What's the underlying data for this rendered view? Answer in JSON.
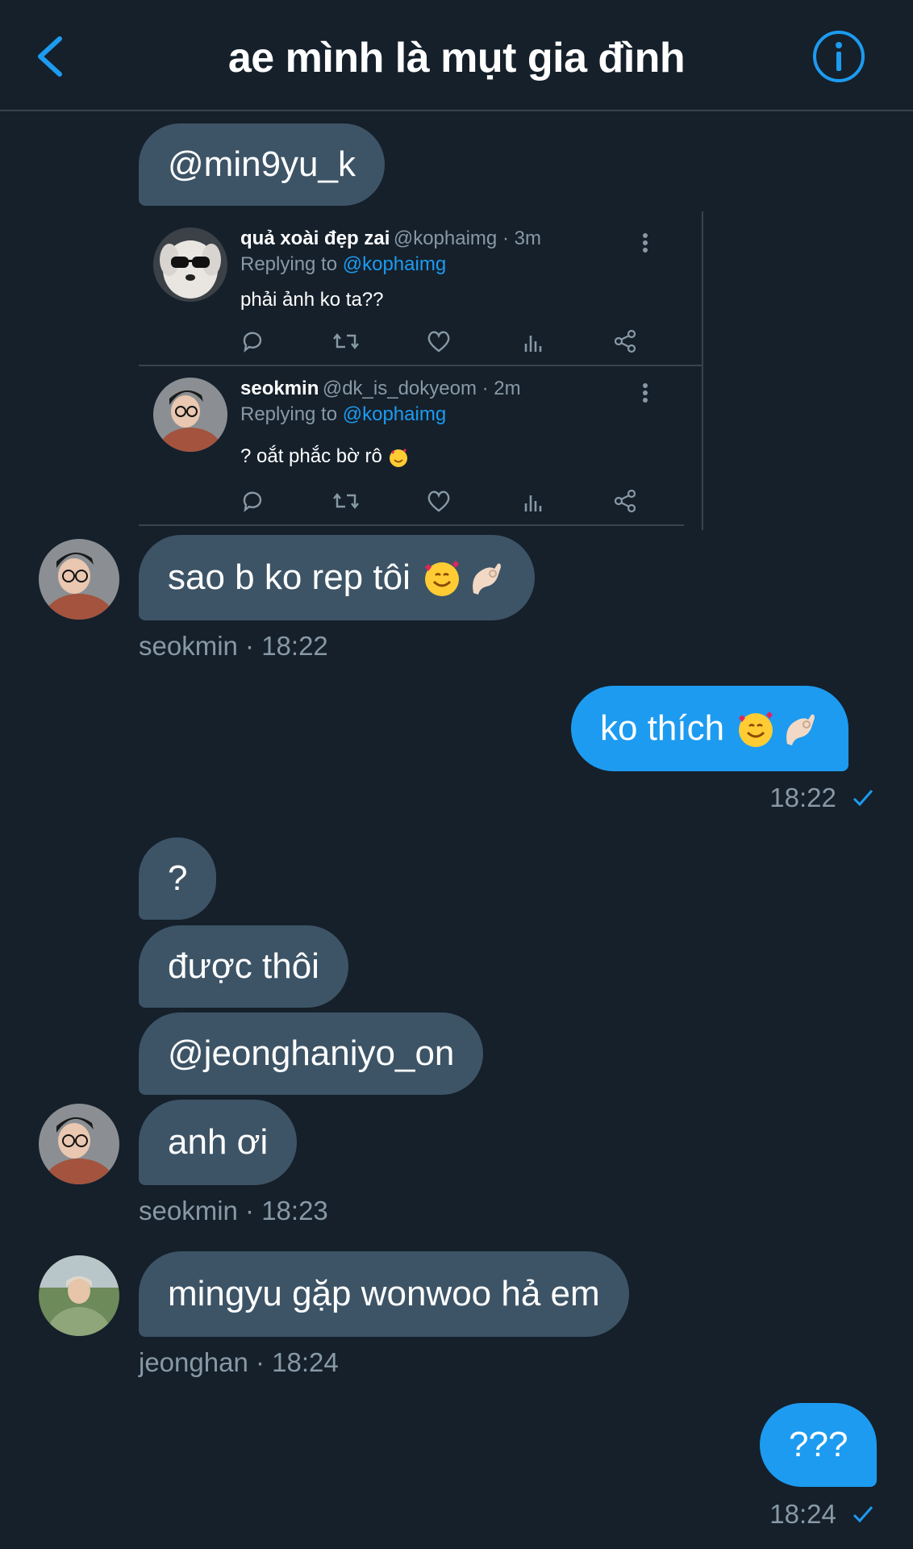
{
  "header": {
    "title": "ae mình là mụt gia đình",
    "back_icon": "chevron-left-icon",
    "info_icon": "info-circle-icon",
    "accent": "#1d9bf0"
  },
  "messages": [
    {
      "id": "m1",
      "text": "@min9yu_k"
    },
    {
      "id": "m2",
      "text": "sao b ko rep tôi"
    },
    {
      "id": "m2meta",
      "text": "seokmin · 18:22"
    },
    {
      "id": "m3",
      "text": "ko thích"
    },
    {
      "id": "m3meta",
      "text": "18:22"
    },
    {
      "id": "m4",
      "text": "?"
    },
    {
      "id": "m5",
      "text": "được thôi"
    },
    {
      "id": "m6",
      "text": "@jeonghaniyo_on"
    },
    {
      "id": "m7",
      "text": "anh ơi"
    },
    {
      "id": "m7meta",
      "text": "seokmin · 18:23"
    },
    {
      "id": "m8",
      "text": "mingyu gặp wonwoo hả em"
    },
    {
      "id": "m8meta",
      "text": "jeonghan · 18:24"
    },
    {
      "id": "m9",
      "text": "???"
    },
    {
      "id": "m9meta",
      "text": "18:24"
    }
  ],
  "tweets": [
    {
      "name": "quả xoài đẹp zai",
      "handle": "@kophaimg · 3m",
      "replying_prefix": "Replying to",
      "replying_to": "@kophaimg",
      "text": "phải ảnh ko ta??"
    },
    {
      "name": "seokmin",
      "handle": "@dk_is_dokyeom · 2m",
      "replying_prefix": "Replying to",
      "replying_to": "@kophaimg",
      "text": "? oắt phắc bờ rô"
    }
  ],
  "colors": {
    "background": "#15202b",
    "incoming_bubble": "#3d5466",
    "outgoing_bubble": "#1d9bf0",
    "meta_text": "#8899a6"
  }
}
